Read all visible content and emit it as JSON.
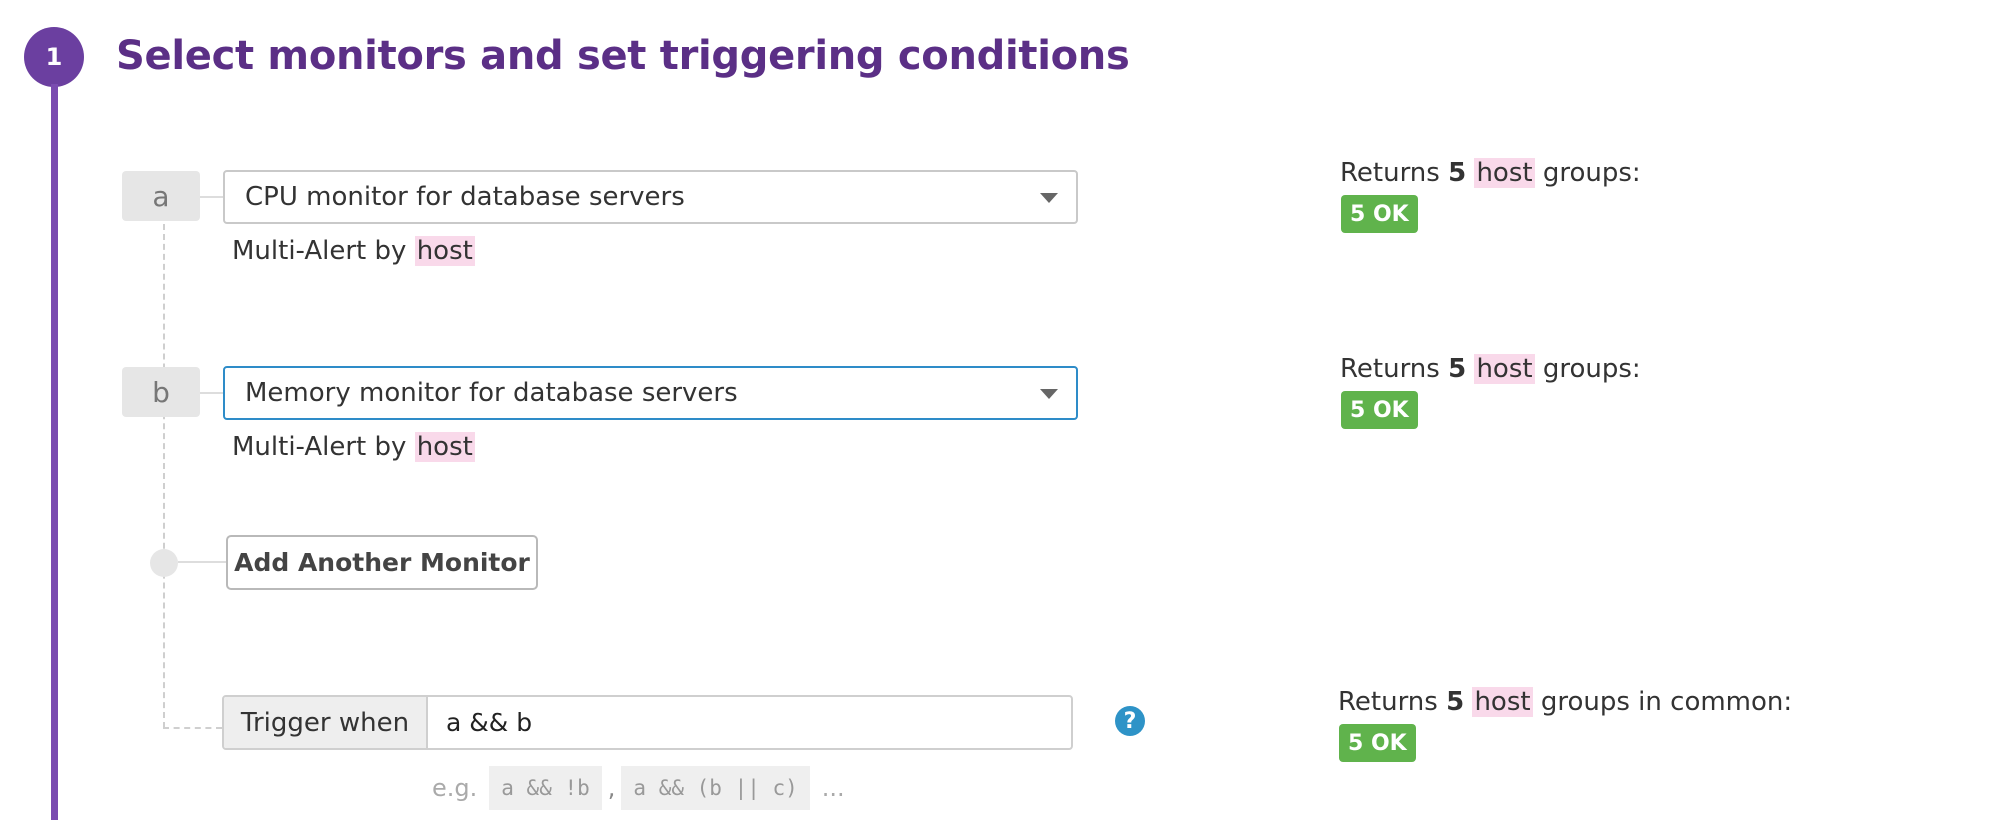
{
  "step": {
    "number": "1",
    "title": "Select monitors and set triggering conditions"
  },
  "monitors": [
    {
      "letter": "a",
      "selected": "CPU monitor for database servers",
      "multi_alert_prefix": "Multi-Alert by",
      "multi_alert_tag": "host",
      "returns_prefix": "Returns",
      "returns_count": "5",
      "returns_tag": "host",
      "returns_suffix": "groups:",
      "status_badge": "5 OK"
    },
    {
      "letter": "b",
      "selected": "Memory monitor for database servers",
      "multi_alert_prefix": "Multi-Alert by",
      "multi_alert_tag": "host",
      "returns_prefix": "Returns",
      "returns_count": "5",
      "returns_tag": "host",
      "returns_suffix": "groups:",
      "status_badge": "5 OK"
    }
  ],
  "add_monitor_label": "Add Another Monitor",
  "trigger": {
    "label": "Trigger when",
    "value": "a && b",
    "help_icon": "?",
    "example_prefix": "e.g.",
    "examples": [
      "a && !b",
      "a && (b || c)"
    ],
    "example_separator": ",",
    "example_ellipsis": "..."
  },
  "common": {
    "returns_prefix": "Returns",
    "returns_count": "5",
    "returns_tag": "host",
    "returns_suffix": "groups in common:",
    "status_badge": "5 OK"
  },
  "colors": {
    "accent_purple": "#5b2f86",
    "ok_green": "#60b34c",
    "tag_pink": "#f9d9ea",
    "focus_blue": "#2e8cc8"
  }
}
